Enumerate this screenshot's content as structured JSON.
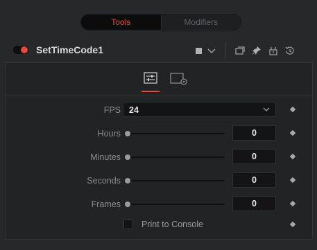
{
  "top_tabs": [
    {
      "label": "Tools",
      "active": true
    },
    {
      "label": "Modifiers",
      "active": false
    }
  ],
  "node": {
    "name": "SetTimeCode1",
    "enabled": true,
    "header_icons": [
      "color-swatch-icon",
      "chevron-down-icon",
      "versions-icon",
      "pin-icon",
      "lock-icon",
      "reset-icon"
    ]
  },
  "panel_tabs": [
    {
      "icon": "controls-sliders-icon",
      "active": true
    },
    {
      "icon": "settings-gear-tab-icon",
      "active": false
    }
  ],
  "controls": {
    "fps": {
      "label": "FPS",
      "value": "24"
    },
    "hours": {
      "label": "Hours",
      "value": "0"
    },
    "minutes": {
      "label": "Minutes",
      "value": "0"
    },
    "seconds": {
      "label": "Seconds",
      "value": "0"
    },
    "frames": {
      "label": "Frames",
      "value": "0"
    },
    "print_to_console": {
      "label": "Print to Console",
      "checked": false
    }
  },
  "colors": {
    "accent": "#e64a3b",
    "background": "#27282a",
    "panel": "#222325"
  }
}
